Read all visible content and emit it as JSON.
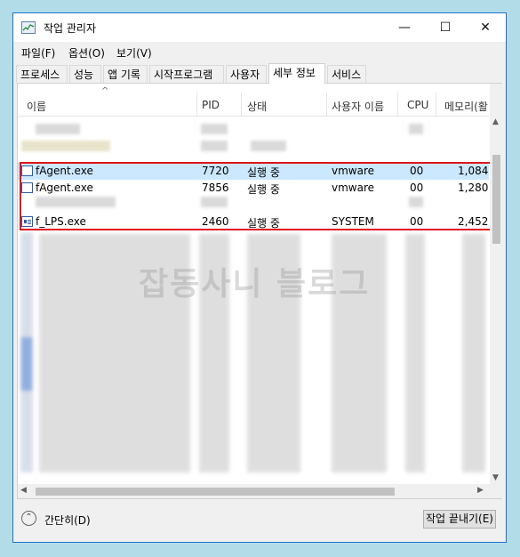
{
  "window": {
    "title": "작업 관리자",
    "controls": {
      "minimize": "—",
      "maximize": "☐",
      "close": "✕"
    }
  },
  "menu": [
    "파일(F)",
    "옵션(O)",
    "보기(V)"
  ],
  "tabs": [
    {
      "label": "프로세스",
      "active": false
    },
    {
      "label": "성능",
      "active": false
    },
    {
      "label": "앱 기록",
      "active": false
    },
    {
      "label": "시작프로그램",
      "active": false
    },
    {
      "label": "사용자",
      "active": false
    },
    {
      "label": "세부 정보",
      "active": true
    },
    {
      "label": "서비스",
      "active": false
    }
  ],
  "columns": [
    "이름",
    "PID",
    "상태",
    "사용자 이름",
    "CPU",
    "메모리(활"
  ],
  "rows": [
    {
      "name": "fAgent.exe",
      "pid": "7720",
      "status": "실행 중",
      "user": "vmware",
      "cpu": "00",
      "memory": "1,084",
      "selected": true
    },
    {
      "name": "fAgent.exe",
      "pid": "7856",
      "status": "실행 중",
      "user": "vmware",
      "cpu": "00",
      "memory": "1,280",
      "selected": false
    },
    {
      "name": "f_LPS.exe",
      "pid": "2460",
      "status": "실행 중",
      "user": "SYSTEM",
      "cpu": "00",
      "memory": "2,452",
      "selected": false
    }
  ],
  "watermark": "잡동사니 블로그",
  "footer": {
    "collapse_label": "간단히(D)",
    "end_task_label": "작업 끝내기(E)"
  }
}
